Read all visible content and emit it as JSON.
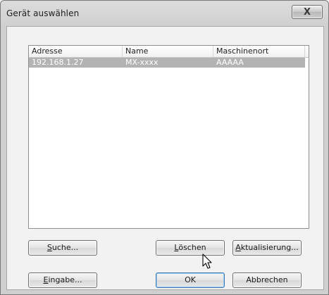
{
  "window": {
    "title": "Gerät auswählen",
    "close_label": "X"
  },
  "list": {
    "columns": [
      "Adresse",
      "Name",
      "Maschinenort"
    ],
    "rows": [
      {
        "address": "192.168.1.27",
        "name": "MX-xxxx",
        "location": "AAAAA",
        "selected": true
      }
    ]
  },
  "buttons": {
    "search": {
      "underlined": "S",
      "rest": "uche..."
    },
    "delete": {
      "underlined": "L",
      "rest": "öschen"
    },
    "refresh": {
      "underlined": "A",
      "rest": "ktualisierung..."
    },
    "input": {
      "underlined": "E",
      "rest": "ingabe..."
    },
    "ok": "OK",
    "cancel": "Abbrechen"
  },
  "colors": {
    "selected_row": "#b3b3b3",
    "default_button_border": "#3d7ab6"
  },
  "icons": {
    "close": "close-icon",
    "pointer": "mouse-pointer-icon"
  }
}
